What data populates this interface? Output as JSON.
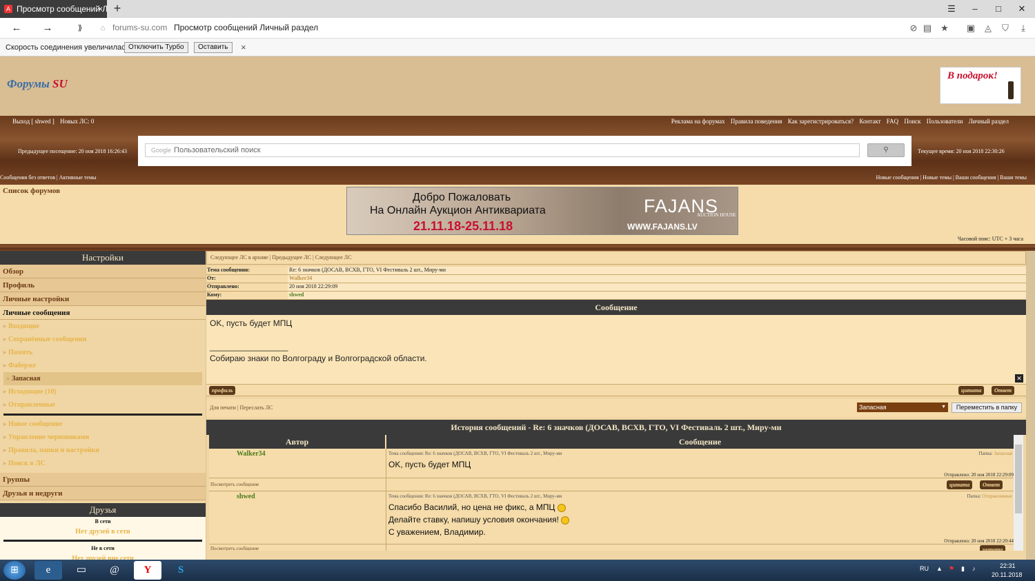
{
  "browser": {
    "tab_title": "Просмотр сообщений Л",
    "tab_close": "×",
    "new_tab": "+",
    "url_host": "forums-su.com",
    "url_title": "Просмотр сообщений Личный раздел",
    "turbo_message": "Скорость соединения увеличилась.",
    "turbo_off": "Отключить Турбо",
    "turbo_keep": "Оставить",
    "turbo_close": "×"
  },
  "header": {
    "logo_main": "Форумы",
    "logo_accent": "SU",
    "gift": "В подарок!"
  },
  "topnav": {
    "left": [
      "Выход [ shwed ]",
      "Новых ЛС: 0"
    ],
    "right": [
      "Реклама на форумах",
      "Правила поведения",
      "Как зарегистрироваться?",
      "Контакт",
      "FAQ",
      "Поиск",
      "Пользователи",
      "Личный раздел"
    ]
  },
  "search": {
    "google_label": "Google",
    "placeholder": "Пользовательский поиск",
    "button_icon": "search-icon",
    "last_visit": "Предыдущее посещение: 20 ноя 2018 16:26:43",
    "current_time": "Текущее время: 20 ноя 2018 22:30:26"
  },
  "sublinks": {
    "left": "Сообщения без ответов | Активные темы",
    "right": "Новые сообщения | Новые темы | Ваши сообщения | Ваши темы"
  },
  "banner": {
    "forum_list": "Список форумов",
    "line1": "Добро Пожаловать",
    "line2": "На Онлайн Аукцион Антиквариата",
    "line3": "21.11.18-25.11.18",
    "brand": "FAJANS",
    "brand_sub": "AUCTION HOUSE",
    "site": "WWW.FAJANS.LV",
    "timezone": "Часовой пояс: UTC + 3 часа"
  },
  "sidebar": {
    "title": "Настройки",
    "sections": [
      "Обзор",
      "Профиль",
      "Личные настройки"
    ],
    "pm_title": "Личные сообщения",
    "pm_items": [
      "Входящие",
      "Сохранённые сообщения",
      "Память",
      "Фаберже",
      "Запасная",
      "Исходящие (10)",
      "Отправленные"
    ],
    "pm_actions": [
      "Новое сообщение",
      "Управление черновиками",
      "Правила, папки и настройки",
      "Поиск в ЛС"
    ],
    "groups": "Группы",
    "friends_foes": "Друзья и недруги",
    "friends_title": "Друзья",
    "online_label": "В сети",
    "online_none": "Нет друзей в сети",
    "offline_label": "Не в сети",
    "offline_none": "Нет друзей вне сети"
  },
  "message": {
    "nav": "Следующее ЛС в архиве | Предыдущее ЛС | Следующее ЛС",
    "subject_label": "Тема сообщения:",
    "subject": "Re: 6 значков (ДОСАВ, ВСХВ, ГТО, VI Фестиваль 2 шт., Миру-ми",
    "from_label": "От:",
    "from": "Walker34",
    "sent_label": "Отправлено:",
    "sent": "20 ноя 2018 22:29:09",
    "to_label": "Кому:",
    "to": "shwed",
    "header": "Сообщение",
    "body_line1": "OK, пусть будет МПЦ",
    "body_sig_rule": "_________________",
    "body_sig": "Собираю знаки по Волгограду и Волгоградской области.",
    "profile_btn": "профиль",
    "quote_btn": "цитата",
    "reply_btn": "Ответ",
    "print_links": "Для печати | Переслать ЛС",
    "folder_value": "Запасная",
    "move_btn": "Переместить в папку"
  },
  "history": {
    "title": "История сообщений - Re: 6 значков (ДОСАВ, ВСХВ, ГТО, VI Фестиваль 2 шт., Миру-ми",
    "col_author": "Автор",
    "col_message": "Сообщение",
    "view_link": "Посмотреть сообщение",
    "rows": [
      {
        "author": "Walker34",
        "subject": "Тема сообщения: Re: 6 значков (ДОСАВ, ВСХВ, ГТО, VI Фестиваль 2 шт., Миру-ми",
        "folder_label": "Папка:",
        "folder": "Запасная",
        "text1": "OK, пусть будет МПЦ",
        "date": "Отправлено: 20 ноя 2018 22:29:09"
      },
      {
        "author": "shwed",
        "subject": "Тема сообщения: Re: 6 значков (ДОСАВ, ВСХВ, ГТО, VI Фестиваль 2 шт., Миру-ми",
        "folder_label": "Папка:",
        "folder": "Отправленные",
        "text1": "Спасибо Василий, но цена не фикс, а МПЦ",
        "text2": "Делайте ставку, напишу условия окончания!",
        "text3": "С уважением, Владимир.",
        "date": "Отправлено: 20 ноя 2018 22:20:44"
      }
    ]
  },
  "taskbar": {
    "lang": "RU",
    "time": "22:31",
    "date": "20.11.2018"
  }
}
